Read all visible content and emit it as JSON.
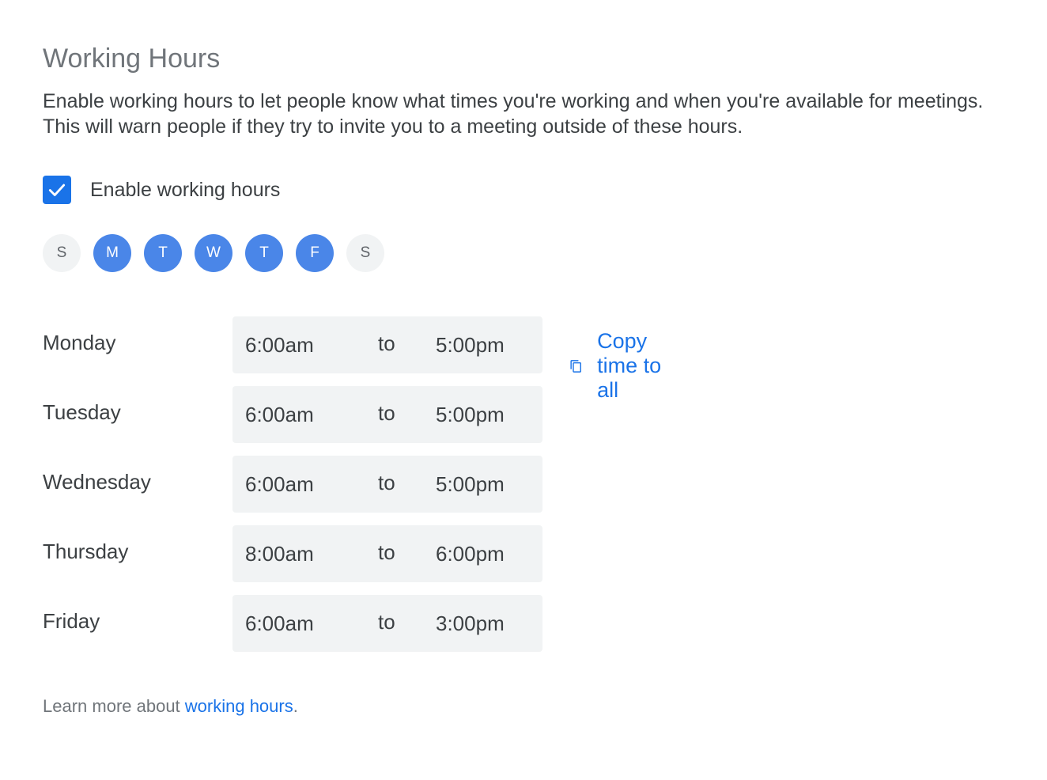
{
  "section": {
    "title": "Working Hours",
    "description": "Enable working hours to let people know what times you're working and when you're available for meetings. This will warn people if they try to invite you to a meeting outside of these hours."
  },
  "enable": {
    "label": "Enable working hours",
    "checked": true
  },
  "days_selector": [
    {
      "letter": "S",
      "selected": false
    },
    {
      "letter": "M",
      "selected": true
    },
    {
      "letter": "T",
      "selected": true
    },
    {
      "letter": "W",
      "selected": true
    },
    {
      "letter": "T",
      "selected": true
    },
    {
      "letter": "F",
      "selected": true
    },
    {
      "letter": "S",
      "selected": false
    }
  ],
  "schedule": [
    {
      "day": "Monday",
      "start": "6:00am",
      "to": "to",
      "end": "5:00pm"
    },
    {
      "day": "Tuesday",
      "start": "6:00am",
      "to": "to",
      "end": "5:00pm"
    },
    {
      "day": "Wednesday",
      "start": "6:00am",
      "to": "to",
      "end": "5:00pm"
    },
    {
      "day": "Thursday",
      "start": "8:00am",
      "to": "to",
      "end": "6:00pm"
    },
    {
      "day": "Friday",
      "start": "6:00am",
      "to": "to",
      "end": "3:00pm"
    }
  ],
  "copy_action": {
    "label": "Copy time to all",
    "icon": "copy-icon"
  },
  "footer": {
    "prefix": "Learn more about ",
    "link_text": "working hours",
    "suffix": "."
  },
  "colors": {
    "accent": "#1a73e8",
    "day_selected": "#4a86e8",
    "day_unselected": "#f1f3f4",
    "time_box": "#f1f3f4"
  }
}
